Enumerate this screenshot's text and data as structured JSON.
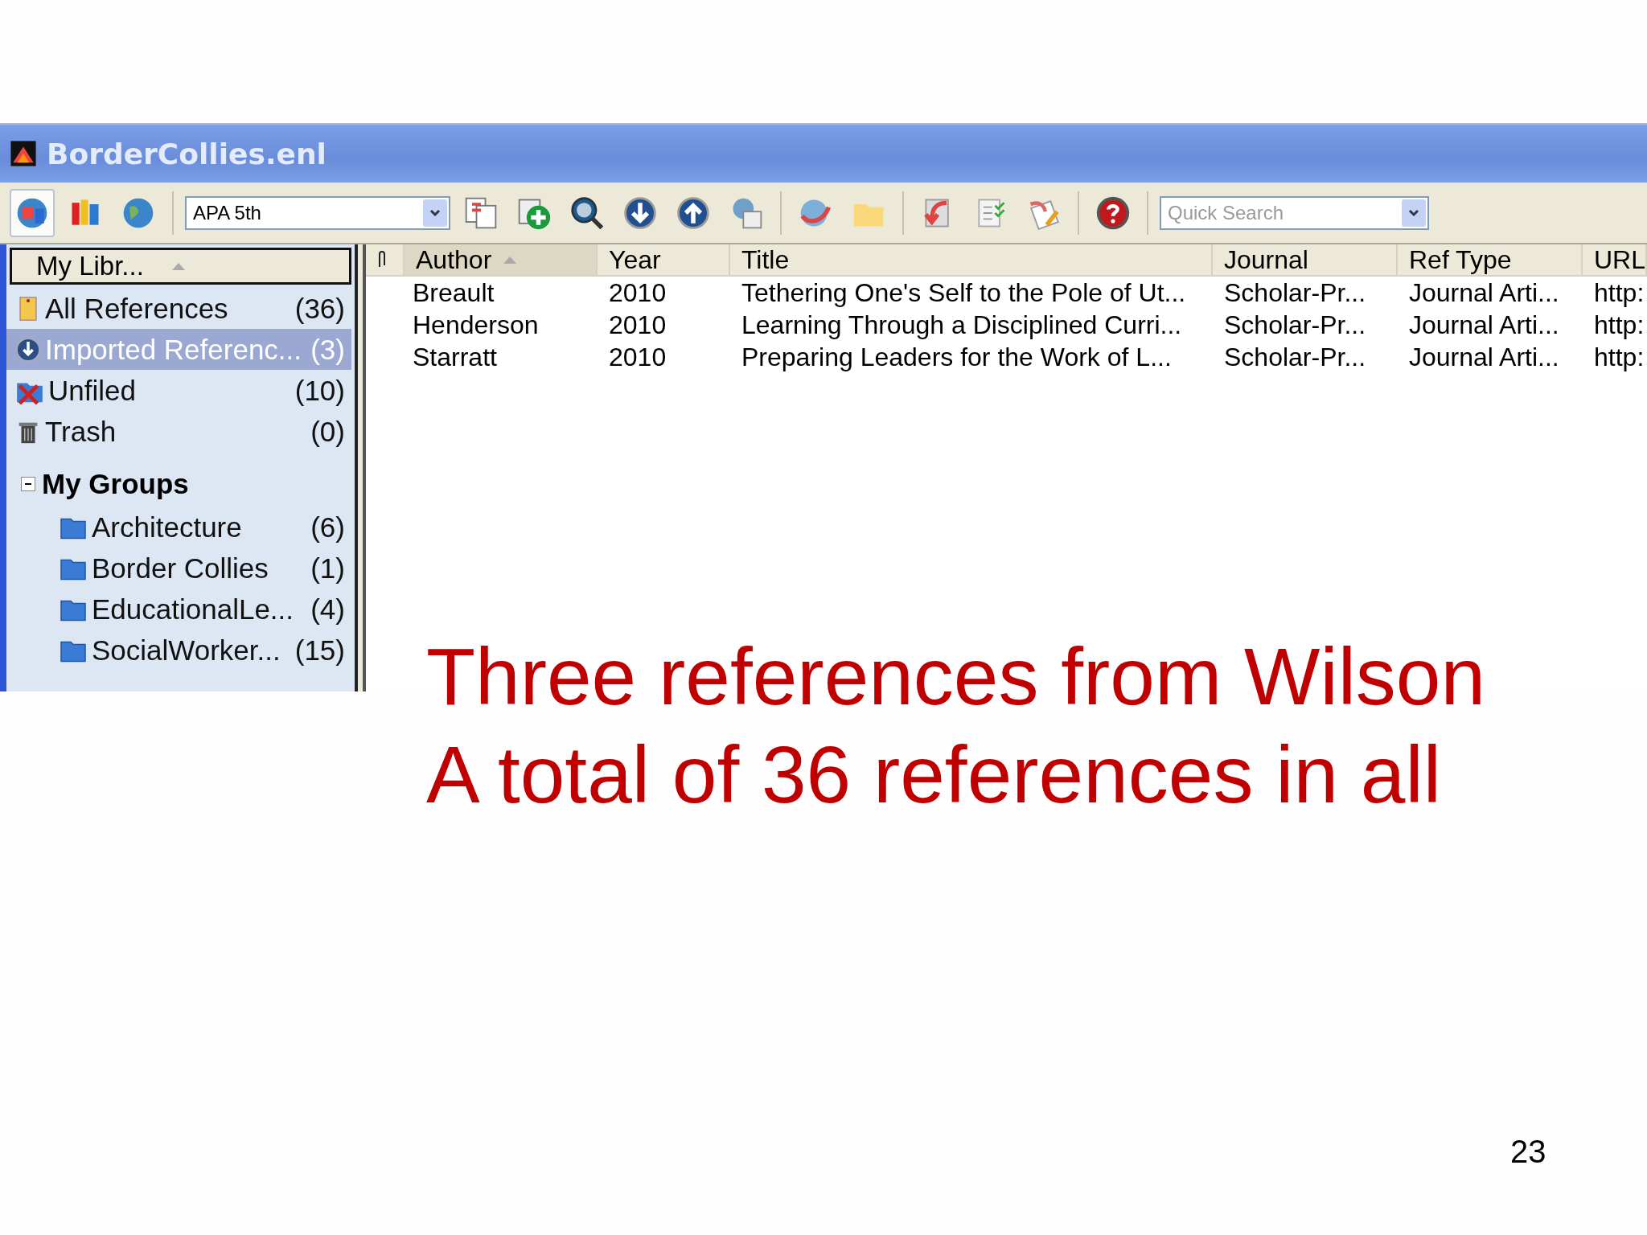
{
  "window": {
    "title": "BorderCollies.enl"
  },
  "toolbar": {
    "style": "APA 5th",
    "search": {
      "placeholder": "Quick Search"
    }
  },
  "sidebar": {
    "header": "My Libr...",
    "items": [
      {
        "label": "All References",
        "count": "(36)",
        "kind": "all",
        "selected": false
      },
      {
        "label": "Imported Referenc...",
        "count": "(3)",
        "kind": "imported",
        "selected": true
      },
      {
        "label": "Unfiled",
        "count": "(10)",
        "kind": "unfiled",
        "selected": false
      },
      {
        "label": "Trash",
        "count": "(0)",
        "kind": "trash",
        "selected": false
      }
    ],
    "groups": {
      "label": "My Groups",
      "expanded": true,
      "children": [
        {
          "label": "Architecture",
          "count": "(6)",
          "selected": false
        },
        {
          "label": "Border Collies",
          "count": "(1)",
          "selected": false
        },
        {
          "label": "EducationalLe...",
          "count": "(4)",
          "selected": false
        },
        {
          "label": "SocialWorker...",
          "count": "(15)",
          "selected": false
        }
      ]
    }
  },
  "table": {
    "columns": [
      {
        "label": "Author",
        "sorted": true
      },
      {
        "label": "Year",
        "sorted": false
      },
      {
        "label": "Title",
        "sorted": false
      },
      {
        "label": "Journal",
        "sorted": false
      },
      {
        "label": "Ref Type",
        "sorted": false
      },
      {
        "label": "URL",
        "sorted": false
      }
    ],
    "rows": [
      {
        "cells": [
          "Breault",
          "2010",
          "Tethering One's Self to the Pole of Ut...",
          "Scholar-Pr...",
          "Journal Arti...",
          "http:"
        ]
      },
      {
        "cells": [
          "Henderson",
          "2010",
          "Learning Through a Disciplined Curri...",
          "Scholar-Pr...",
          "Journal Arti...",
          "http:"
        ]
      },
      {
        "cells": [
          "Starratt",
          "2010",
          "Preparing Leaders for the Work of L...",
          "Scholar-Pr...",
          "Journal Arti...",
          "http:"
        ]
      }
    ]
  },
  "caption": [
    "Three references from Wilson",
    "A total of 36 references in all"
  ],
  "slide_number": "23"
}
